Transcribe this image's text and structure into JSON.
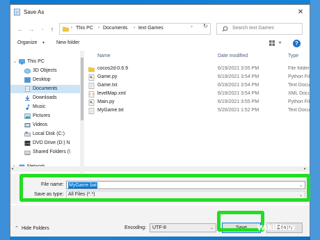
{
  "window": {
    "title": "Save As",
    "close_glyph": "✕"
  },
  "address": {
    "breadcrumbs": [
      "This PC",
      "Documents",
      "text Games"
    ],
    "search_placeholder": "Search text Games"
  },
  "toolbar": {
    "organize_label": "Organize",
    "new_folder_label": "New folder",
    "help_glyph": "?"
  },
  "nav_pane": {
    "items": [
      {
        "label": "This PC",
        "icon": "computer-icon"
      },
      {
        "label": "3D Objects",
        "icon": "3d-objects-icon"
      },
      {
        "label": "Desktop",
        "icon": "desktop-icon"
      },
      {
        "label": "Documents",
        "icon": "documents-icon",
        "selected": true
      },
      {
        "label": "Downloads",
        "icon": "download-icon"
      },
      {
        "label": "Music",
        "icon": "music-icon"
      },
      {
        "label": "Pictures",
        "icon": "pictures-icon"
      },
      {
        "label": "Videos",
        "icon": "videos-icon"
      },
      {
        "label": "Local Disk (C:)",
        "icon": "drive-icon"
      },
      {
        "label": "DVD Drive (D:) N",
        "icon": "dvd-drive-icon"
      },
      {
        "label": "Shared Folders (\\",
        "icon": "shared-folder-icon"
      },
      {
        "label": "Network",
        "icon": "network-icon"
      }
    ]
  },
  "file_list": {
    "columns": [
      "Name",
      "Date modified",
      "Type"
    ],
    "rows": [
      {
        "name": "cocos2d-0.6.9",
        "date": "6/19/2021 3:55 PM",
        "type": "File folder",
        "icon": "folder-icon"
      },
      {
        "name": "Game.py",
        "date": "6/19/2021 3:54 PM",
        "type": "Python File",
        "icon": "python-file-icon"
      },
      {
        "name": "Game.txt",
        "date": "6/19/2021 3:54 PM",
        "type": "Text Document",
        "icon": "text-file-icon"
      },
      {
        "name": "levelMap.xml",
        "date": "6/19/2021 3:54 PM",
        "type": "XML Document",
        "icon": "xml-file-icon"
      },
      {
        "name": "Main.py",
        "date": "6/19/2021 3:55 PM",
        "type": "Python File",
        "icon": "python-file-icon"
      },
      {
        "name": "MyGame.txt",
        "date": "5/20/2021 1:52 PM",
        "type": "Text Document",
        "icon": "text-file-icon"
      }
    ]
  },
  "form": {
    "file_name_label": "File name:",
    "file_name_value": "MyGame.bat",
    "save_as_type_label": "Save as type:",
    "save_as_type_value": "All Files  (*.*)"
  },
  "footer": {
    "hide_folders_label": "Hide Folders",
    "encoding_label": "Encoding:",
    "encoding_value": "UTF-8",
    "save_label": "Save",
    "cancel_label": "Cancel"
  },
  "watermark": "wikiHow",
  "colors": {
    "highlight": "#22dd22",
    "selection": "#0078d7",
    "desktop": "#0b79d0"
  }
}
